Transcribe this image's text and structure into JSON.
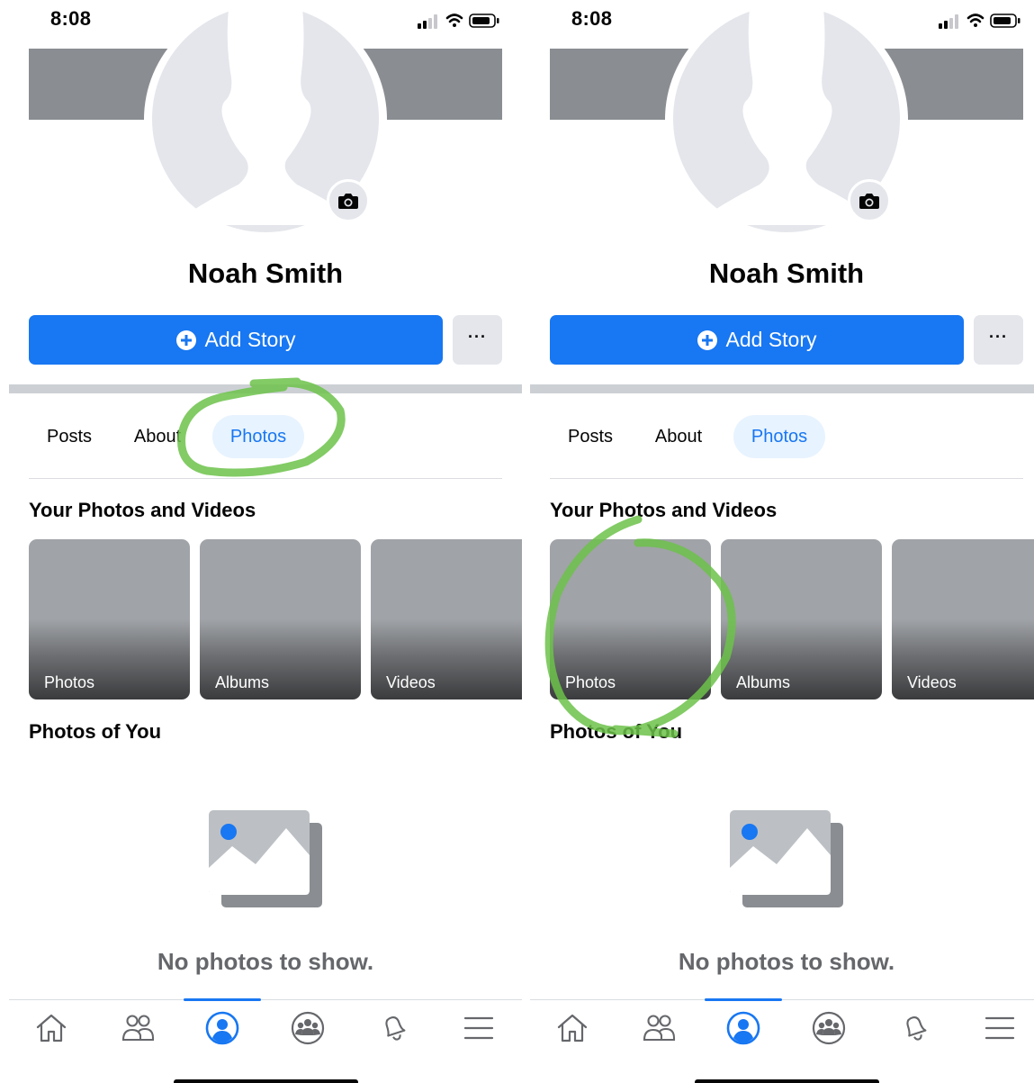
{
  "panels": [
    {
      "status": {
        "time": "8:08"
      },
      "profile": {
        "name": "Noah Smith"
      },
      "actions": {
        "add_story": "Add Story",
        "more": "···"
      },
      "tabs": [
        {
          "label": "Posts"
        },
        {
          "label": "About"
        },
        {
          "label": "Photos"
        }
      ],
      "sections": {
        "your_photos": "Your Photos and Videos",
        "photos_of_you": "Photos of You"
      },
      "tiles": [
        {
          "label": "Photos"
        },
        {
          "label": "Albums"
        },
        {
          "label": "Videos"
        }
      ],
      "empty_state": {
        "text": "No photos to show."
      },
      "annotation": {
        "color": "#6cc24a",
        "target": "Photos tab"
      }
    },
    {
      "status": {
        "time": "8:08"
      },
      "profile": {
        "name": "Noah Smith"
      },
      "actions": {
        "add_story": "Add Story",
        "more": "···"
      },
      "tabs": [
        {
          "label": "Posts"
        },
        {
          "label": "About"
        },
        {
          "label": "Photos"
        }
      ],
      "sections": {
        "your_photos": "Your Photos and Videos",
        "photos_of_you": "Photos of You"
      },
      "tiles": [
        {
          "label": "Photos"
        },
        {
          "label": "Albums"
        },
        {
          "label": "Videos"
        }
      ],
      "empty_state": {
        "text": "No photos to show."
      },
      "annotation": {
        "color": "#6cc24a",
        "target": "Photos tile"
      }
    }
  ],
  "bottom_nav": {
    "items": [
      {
        "icon": "home-icon"
      },
      {
        "icon": "friends-icon"
      },
      {
        "icon": "profile-icon",
        "active": true
      },
      {
        "icon": "groups-icon"
      },
      {
        "icon": "bell-icon"
      },
      {
        "icon": "menu-icon"
      }
    ],
    "active_color": "#1877f2",
    "inactive_color": "#65676b"
  },
  "colors": {
    "accent": "#1877f2",
    "cover": "#8a8d91",
    "tab_active_bg": "#e7f3ff",
    "annotation": "#6cc24a"
  }
}
